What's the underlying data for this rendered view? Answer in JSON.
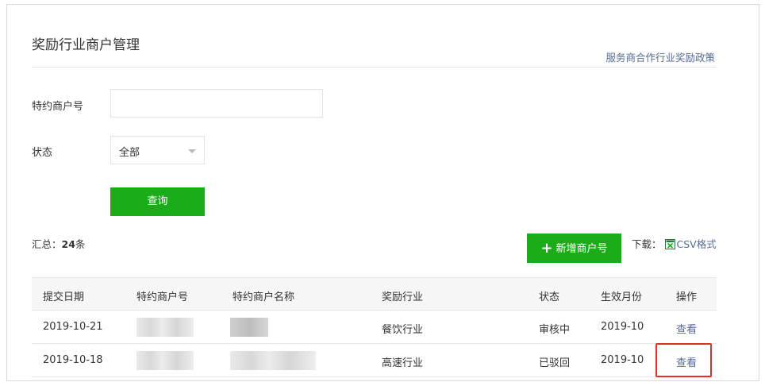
{
  "page": {
    "title": "奖励行业商户管理",
    "policy_link": "服务商合作行业奖励政策"
  },
  "filters": {
    "merchant_label": "特约商户号",
    "merchant_value": "",
    "status_label": "状态",
    "status_selected": "全部",
    "query_button": "查询"
  },
  "summary": {
    "prefix": "汇总：",
    "count": "24",
    "suffix": "条"
  },
  "actions": {
    "add_button": "新增商户号",
    "download_label": "下载：",
    "csv_link": "CSV格式"
  },
  "table": {
    "headers": [
      "提交日期",
      "特约商户号",
      "特约商户名称",
      "奖励行业",
      "状态",
      "生效月份",
      "操作"
    ],
    "rows": [
      {
        "date": "2019-10-21",
        "industry": "餐饮行业",
        "status": "审核中",
        "month": "2019-10",
        "action": "查看"
      },
      {
        "date": "2019-10-18",
        "industry": "高速行业",
        "status": "已驳回",
        "month": "2019-10",
        "action": "查看"
      }
    ]
  },
  "colors": {
    "primary_green": "#1aad19",
    "link_blue": "#576b95",
    "highlight_red": "#e0302a"
  }
}
